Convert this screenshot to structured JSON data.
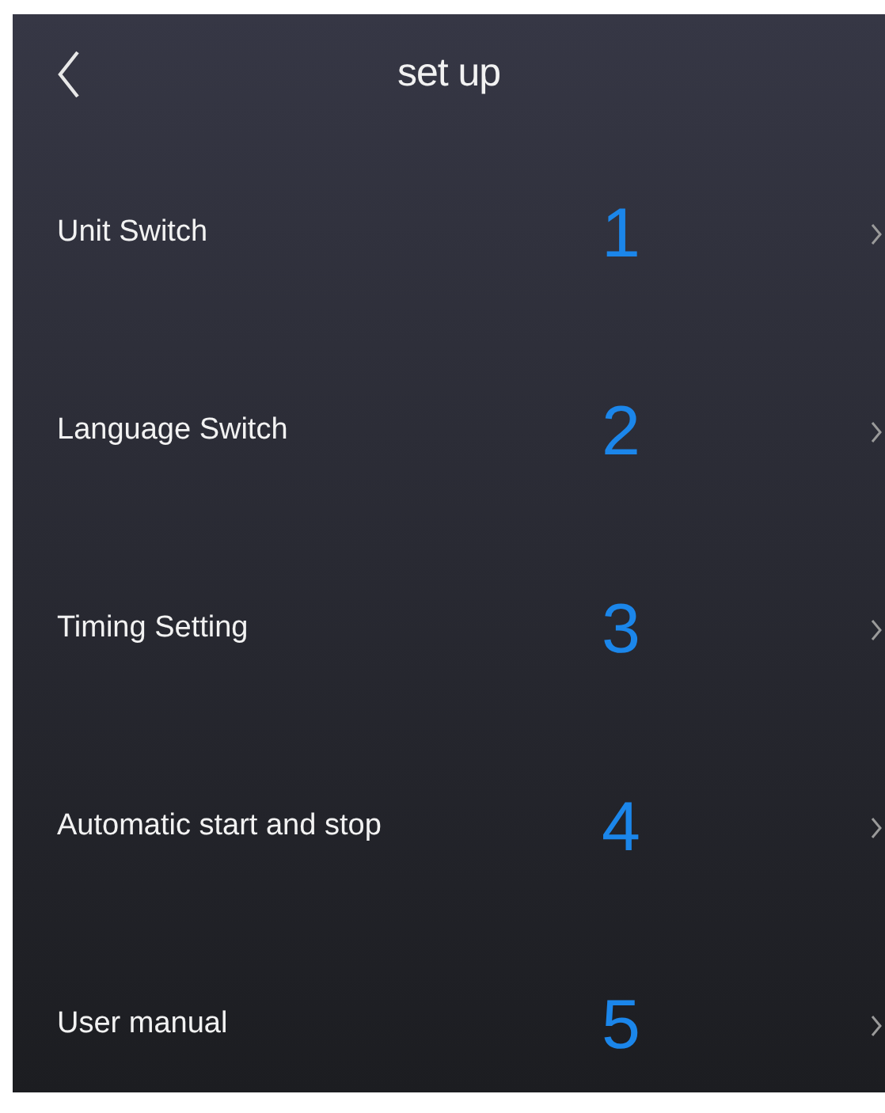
{
  "header": {
    "title": "set up"
  },
  "items": [
    {
      "label": "Unit Switch",
      "number": "1"
    },
    {
      "label": "Language Switch",
      "number": "2"
    },
    {
      "label": "Timing Setting",
      "number": "3"
    },
    {
      "label": "Automatic start and stop",
      "number": "4"
    },
    {
      "label": "User manual",
      "number": "5"
    }
  ]
}
